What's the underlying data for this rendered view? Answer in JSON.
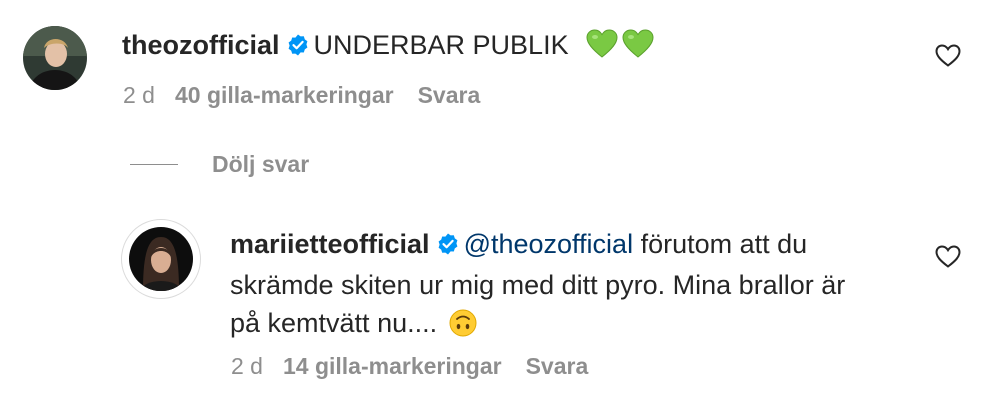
{
  "comments": [
    {
      "username": "theozofficial",
      "text": "UNDERBAR PUBLIK",
      "emoji": [
        "green-heart",
        "green-heart"
      ],
      "time": "2 d",
      "likes": "40 gilla-markeringar",
      "reply": "Svara"
    }
  ],
  "hide_replies_label": "Dölj svar",
  "replies": [
    {
      "username": "mariietteofficial",
      "mention": "@theozofficial",
      "text_line1": " förutom att du",
      "text_line2": "skrämde skiten ur mig med ditt pyro. Mina brallor är",
      "text_line3": "på kemtvätt nu....",
      "emoji": [
        "upside-down-face"
      ],
      "time": "2 d",
      "likes": "14 gilla-markeringar",
      "reply": "Svara"
    }
  ],
  "colors": {
    "text": "#262626",
    "secondary": "#8e8e8e",
    "mention": "#00376b",
    "verified": "#0095f6",
    "green_heart": "#7ac943"
  }
}
